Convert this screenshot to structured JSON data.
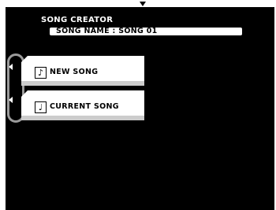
{
  "header": {
    "title": "SONG CREATOR",
    "song_name_text": "SONG NAME : SONG 01"
  },
  "menu": {
    "items": [
      {
        "label": "NEW SONG",
        "icon": "note-icon",
        "glyph": "♪"
      },
      {
        "label": "CURRENT SONG",
        "icon": "note-icon",
        "glyph": "♩"
      }
    ]
  },
  "colors": {
    "screen": "#000000",
    "panel": "#ffffff",
    "selection_ring": "#9b9b9b"
  }
}
